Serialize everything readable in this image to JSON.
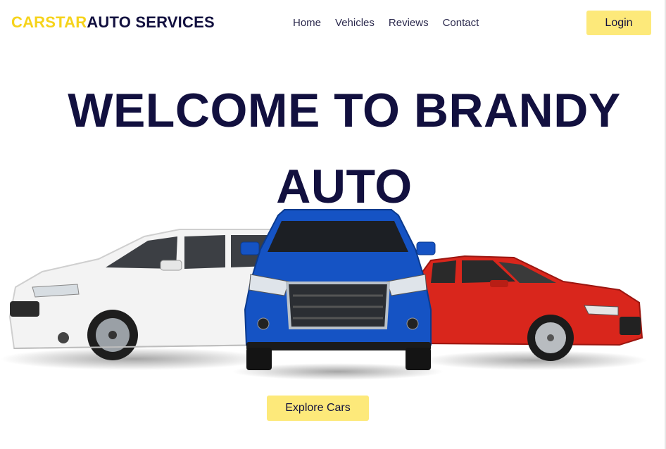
{
  "header": {
    "brand_part1": "CARSTAR",
    "brand_part2": "AUTO SERVICES",
    "nav": [
      "Home",
      "Vehicles",
      "Reviews",
      "Contact"
    ],
    "login_label": "Login"
  },
  "hero": {
    "title_line1": "WELCOME TO BRANDY",
    "title_line2": "AUTO",
    "cta_label": "Explore Cars"
  },
  "colors": {
    "brand_yellow": "#f6d31b",
    "navy": "#12103f",
    "button_yellow": "#fde97a",
    "car_white": "#f2f2f2",
    "car_blue": "#1553c4",
    "car_red": "#d9261c"
  }
}
